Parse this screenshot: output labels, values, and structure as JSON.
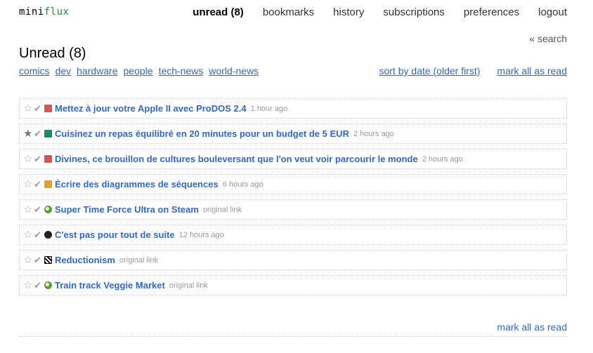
{
  "logo": {
    "part1": "mini",
    "part2": "flux"
  },
  "nav": [
    {
      "label": "unread (8)",
      "active": true
    },
    {
      "label": "bookmarks"
    },
    {
      "label": "history"
    },
    {
      "label": "subscriptions"
    },
    {
      "label": "preferences"
    },
    {
      "label": "logout"
    }
  ],
  "search_link": "« search",
  "page_title": "Unread (8)",
  "tags": [
    "comics",
    "dev",
    "hardware",
    "people",
    "tech-news",
    "world-news"
  ],
  "actions": {
    "sort": "sort by date (older first)",
    "mark_all": "mark all as read"
  },
  "items": [
    {
      "title": "Mettez à jour votre Apple II avec ProDOS 2.4",
      "meta": "1 hour ago",
      "starred": false,
      "favicon": "red-feed-icon"
    },
    {
      "title": "Cuisinez un repas équilibré en 20 minutes pour un budget de 5 EUR",
      "meta": "2 hours ago",
      "starred": true,
      "favicon": "green-k-icon"
    },
    {
      "title": "Divines, ce brouillon de cultures bouleversant que l'on veut voir parcourir le monde",
      "meta": "2 hours ago",
      "starred": false,
      "favicon": "red-feed-icon"
    },
    {
      "title": "Écrire des diagrammes de séquences",
      "meta": "6 hours ago",
      "starred": false,
      "favicon": "orange-feed-icon"
    },
    {
      "title": "Super Time Force Ultra on Steam",
      "meta": "original link",
      "starred": false,
      "favicon": "green-circle-icon"
    },
    {
      "title": "C'est pas pour tout de suite",
      "meta": "12 hours ago",
      "starred": false,
      "favicon": "dark-animal-icon"
    },
    {
      "title": "Reductionism",
      "meta": "original link",
      "starred": false,
      "favicon": "checker-icon"
    },
    {
      "title": "Train track Veggie Market",
      "meta": "original link",
      "starred": false,
      "favicon": "green-circle-icon"
    }
  ],
  "footer": {
    "mark_all": "mark all as read"
  },
  "colors": {
    "link": "#3366cc",
    "brand_green": "#2a8a3a",
    "meta": "#999999"
  }
}
